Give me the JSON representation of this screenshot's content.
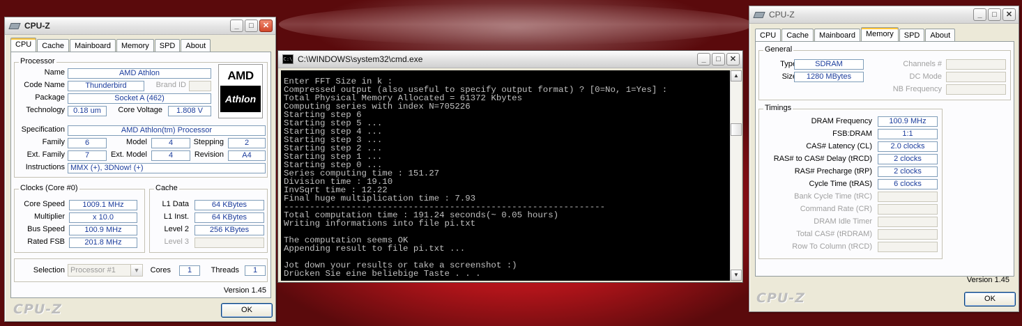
{
  "left": {
    "title": "CPU-Z",
    "tabs": [
      "CPU",
      "Cache",
      "Mainboard",
      "Memory",
      "SPD",
      "About"
    ],
    "processor": {
      "group": "Processor",
      "name_label": "Name",
      "name": "AMD Athlon",
      "codename_label": "Code Name",
      "codename": "Thunderbird",
      "brandid_label": "Brand ID",
      "package_label": "Package",
      "package": "Socket A (462)",
      "technology_label": "Technology",
      "technology": "0.18 um",
      "corevoltage_label": "Core Voltage",
      "corevoltage": "1.808 V",
      "spec_label": "Specification",
      "spec": "AMD Athlon(tm) Processor",
      "family_label": "Family",
      "family": "6",
      "model_label": "Model",
      "model": "4",
      "stepping_label": "Stepping",
      "stepping": "2",
      "extfamily_label": "Ext. Family",
      "extfamily": "7",
      "extmodel_label": "Ext. Model",
      "extmodel": "4",
      "revision_label": "Revision",
      "revision": "A4",
      "instructions_label": "Instructions",
      "instructions": "MMX (+), 3DNow! (+)",
      "logo_top": "AMD",
      "logo_bottom": "Athlon"
    },
    "clocks": {
      "group": "Clocks (Core #0)",
      "corespeed_label": "Core Speed",
      "corespeed": "1009.1 MHz",
      "multiplier_label": "Multiplier",
      "multiplier": "x 10.0",
      "busspeed_label": "Bus Speed",
      "busspeed": "100.9 MHz",
      "ratedfsb_label": "Rated FSB",
      "ratedfsb": "201.8 MHz"
    },
    "cache": {
      "group": "Cache",
      "l1data_label": "L1 Data",
      "l1data": "64 KBytes",
      "l1inst_label": "L1 Inst.",
      "l1inst": "64 KBytes",
      "level2_label": "Level 2",
      "level2": "256 KBytes",
      "level3_label": "Level 3"
    },
    "selection": {
      "label": "Selection",
      "value": "Processor #1",
      "cores_label": "Cores",
      "cores": "1",
      "threads_label": "Threads",
      "threads": "1"
    },
    "version": "Version 1.45",
    "footer_logo": "CPU-Z",
    "ok": "OK"
  },
  "cmd": {
    "title": "C:\\WINDOWS\\system32\\cmd.exe",
    "lines": [
      "Enter FFT Size in k :",
      "Compressed output (also useful to specify output format) ? [0=No, 1=Yes] :",
      "Total Physical Memory Allocated = 61372 Kbytes",
      "Computing series with index N=705226",
      "Starting step 6",
      "Starting step 5 ...",
      "Starting step 4 ...",
      "Starting step 3 ...",
      "Starting step 2 ...",
      "Starting step 1 ...",
      "Starting step 0 ...",
      "Series computing time : 151.27",
      "Division time : 19.10",
      "InvSqrt time : 12.22",
      "Final huge multiplication time : 7.93",
      "--------------------------------------------------------------",
      "Total computation time : 191.24 seconds(~ 0.05 hours)",
      "Writing informations into file pi.txt",
      "",
      "The computation seems OK",
      "Appending result to file pi.txt ...",
      "",
      "Jot down your results or take a screenshot :)",
      "Drücken Sie eine beliebige Taste . . ."
    ]
  },
  "right": {
    "title": "CPU-Z",
    "tabs": [
      "CPU",
      "Cache",
      "Mainboard",
      "Memory",
      "SPD",
      "About"
    ],
    "general": {
      "group": "General",
      "type_label": "Type",
      "type": "SDRAM",
      "size_label": "Size",
      "size": "1280 MBytes",
      "channels_label": "Channels #",
      "dcmode_label": "DC Mode",
      "nbfreq_label": "NB Frequency"
    },
    "timings": {
      "group": "Timings",
      "rows": [
        {
          "label": "DRAM Frequency",
          "value": "100.9 MHz",
          "enabled": true
        },
        {
          "label": "FSB:DRAM",
          "value": "1:1",
          "enabled": true
        },
        {
          "label": "CAS# Latency (CL)",
          "value": "2.0 clocks",
          "enabled": true
        },
        {
          "label": "RAS# to CAS# Delay (tRCD)",
          "value": "2 clocks",
          "enabled": true
        },
        {
          "label": "RAS# Precharge (tRP)",
          "value": "2 clocks",
          "enabled": true
        },
        {
          "label": "Cycle Time (tRAS)",
          "value": "6 clocks",
          "enabled": true
        },
        {
          "label": "Bank Cycle Time (tRC)",
          "value": "",
          "enabled": false
        },
        {
          "label": "Command Rate (CR)",
          "value": "",
          "enabled": false
        },
        {
          "label": "DRAM Idle Timer",
          "value": "",
          "enabled": false
        },
        {
          "label": "Total CAS# (tRDRAM)",
          "value": "",
          "enabled": false
        },
        {
          "label": "Row To Column (tRCD)",
          "value": "",
          "enabled": false
        }
      ]
    },
    "version": "Version 1.45",
    "footer_logo": "CPU-Z",
    "ok": "OK"
  }
}
